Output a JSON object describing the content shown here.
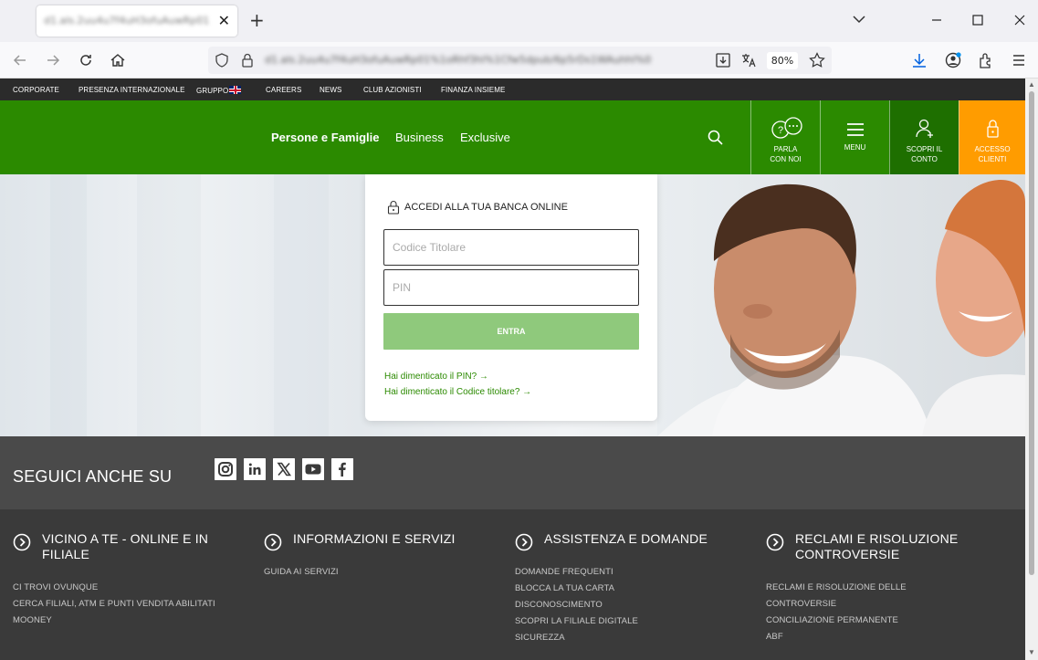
{
  "browser": {
    "tab_title": "d1.als.2uu4u7f4uH3ofuAuwRp01",
    "url": "d1.als.2uu4u7f4uH3ofuAuwRp01%1oRhf3hl%1Cfw5dpub/6p5rDs1WAuhhl%0",
    "zoom": "80%"
  },
  "topnav": {
    "items": [
      "CORPORATE",
      "PRESENZA INTERNAZIONALE",
      "GRUPPO",
      "CAREERS",
      "NEWS",
      "CLUB AZIONISTI",
      "FINANZA INSIEME"
    ]
  },
  "mainnav": {
    "segments": [
      "Persone e Famiglie",
      "Business",
      "Exclusive"
    ],
    "boxes": [
      {
        "label": "PARLA\nCON NOI",
        "icon": "chat-icon"
      },
      {
        "label": "MENU",
        "icon": "hamburger-icon"
      },
      {
        "label": "SCOPRI IL\nCONTO",
        "icon": "add-user-icon"
      },
      {
        "label": "ACCESSO\nCLIENTI",
        "icon": "lock-icon"
      }
    ]
  },
  "login": {
    "title": "ACCEDI ALLA TUA BANCA ONLINE",
    "code_placeholder": "Codice Titolare",
    "pin_placeholder": "PIN",
    "submit_label": "ENTRA",
    "forgot_pin": "Hai dimenticato il PIN? →",
    "forgot_code": "Hai dimenticato il Codice titolare? →"
  },
  "social": {
    "title": "SEGUICI ANCHE SU",
    "networks": [
      "instagram-icon",
      "linkedin-icon",
      "x-icon",
      "youtube-icon",
      "facebook-icon"
    ]
  },
  "footer": {
    "columns": [
      {
        "heading": "VICINO A TE - ONLINE E IN FILIALE",
        "links": [
          "CI TROVI OVUNQUE",
          "CERCA FILIALI, ATM E PUNTI VENDITA ABILITATI",
          "MOONEY"
        ]
      },
      {
        "heading": "INFORMAZIONI E SERVIZI",
        "links": [
          "GUIDA AI SERVIZI"
        ]
      },
      {
        "heading": "ASSISTENZA E DOMANDE",
        "links": [
          "DOMANDE FREQUENTI",
          "BLOCCA LA TUA CARTA",
          "DISCONOSCIMENTO",
          "SCOPRI LA FILIALE DIGITALE",
          "SICUREZZA"
        ]
      },
      {
        "heading": "RECLAMI E RISOLUZIONE CONTROVERSIE",
        "links": [
          "RECLAMI E RISOLUZIONE DELLE",
          "CONTROVERSIE",
          "CONCILIAZIONE PERMANENTE",
          "ABF"
        ]
      }
    ]
  },
  "colors": {
    "brand_green": "#2b8a00",
    "dark_green": "#1e6f00",
    "orange": "#ff9c00",
    "footer_dark": "#3a3a3a"
  }
}
